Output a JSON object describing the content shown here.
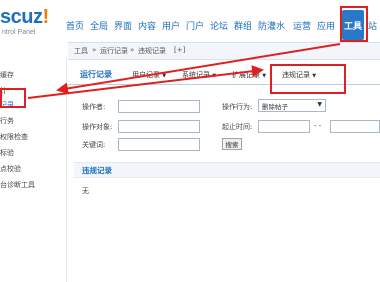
{
  "logo": {
    "brand": "scuz",
    "bang": "!",
    "subtitle": "ntrol Panel"
  },
  "nav": {
    "items": [
      "首页",
      "全局",
      "界面",
      "内容",
      "用户",
      "门户",
      "论坛",
      "群组",
      "防灌水",
      "运营",
      "应用"
    ],
    "active": "工具",
    "overflow": "站"
  },
  "breadcrumb": {
    "root": "工具",
    "sep": "»",
    "mid": "运行记录",
    "current": "违规记录",
    "plus": "[+]"
  },
  "sidebar": {
    "items": [
      "缓存",
      "计",
      "记录",
      "行务",
      "权限检查",
      "标验",
      "点校验",
      "台诊断工具"
    ],
    "active_index": 2
  },
  "tabs": {
    "first": "运行记录",
    "items": [
      "用户记录",
      "系统记录",
      "扩展记录",
      "违规记录"
    ],
    "caret": "▼"
  },
  "form": {
    "operator_label": "操作者:",
    "action_label": "操作行为:",
    "action_value": "删除帖子",
    "target_label": "操作对象:",
    "time_label": "起止时间:",
    "time_sep": "- -",
    "keyword_label": "关键词:",
    "search_button": "搜索"
  },
  "section": {
    "title": "违规记录",
    "empty": "无"
  },
  "colors": {
    "accent": "#1d6fbf",
    "annotation": "#e02020",
    "nav_active_bg": "#2a79c9",
    "logo_bang": "#f07f00"
  }
}
